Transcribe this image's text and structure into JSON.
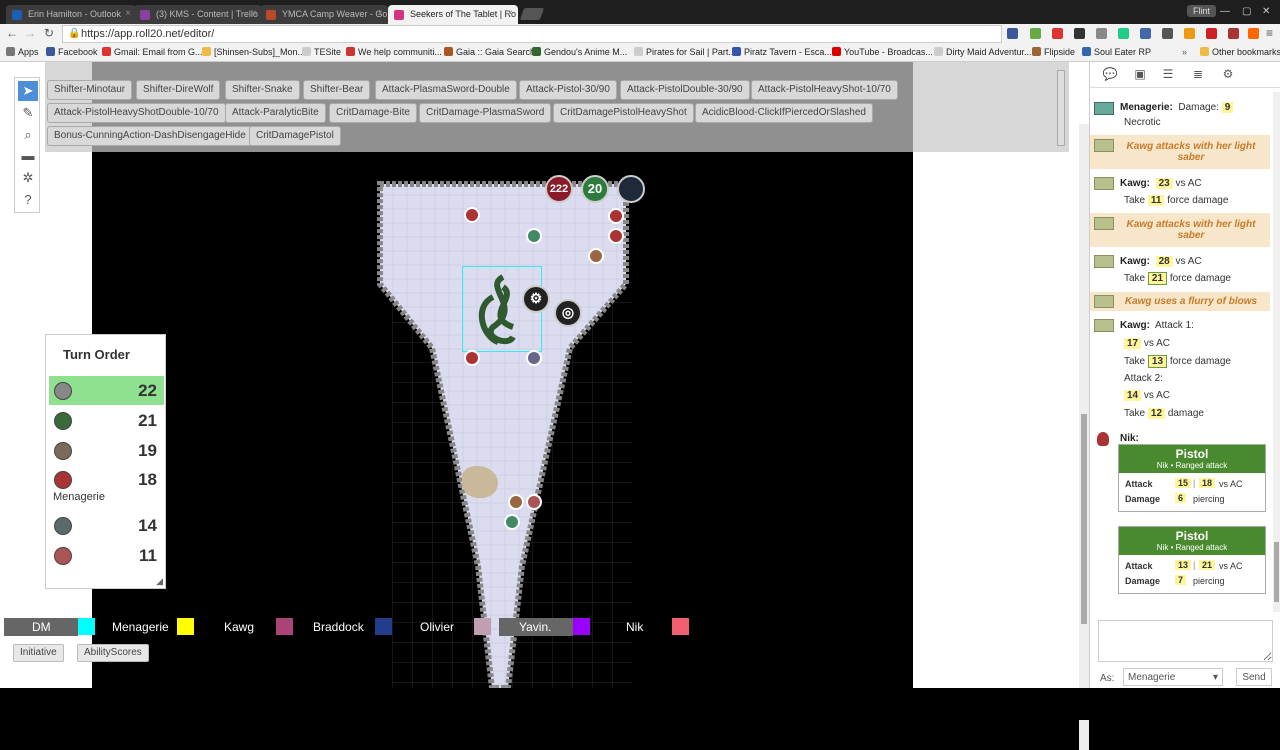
{
  "browser": {
    "tabs": [
      {
        "label": "Erin Hamilton - Outlook",
        "favicon": "#1a5fb4"
      },
      {
        "label": "(3) KMS - Content | Trello",
        "favicon": "#8b3fa0"
      },
      {
        "label": "YMCA Camp Weaver - Go",
        "favicon": "#b84a2b"
      },
      {
        "label": "Seekers of The Tablet | Ro",
        "favicon": "#d6337f"
      }
    ],
    "profile_badge": "Flint",
    "url": "https://app.roll20.net/editor/",
    "bookmarks": [
      "Apps",
      "Facebook",
      "Gmail: Email from G...",
      "[Shinsen-Subs]_Mon...",
      "TESite",
      "We help communiti...",
      "Gaia :: Gaia Search",
      "Gendou's Anime M...",
      "Pirates for Sail | Part...",
      "Piratz Tavern - Esca...",
      "YouTube - Broadcas...",
      "Dirty Maid Adventur...",
      "Flipside",
      "Soul Eater RP"
    ],
    "other_bookmarks": "Other bookmarks"
  },
  "macros": [
    "Shifter-Minotaur",
    "Shifter-DireWolf",
    "Shifter-Snake",
    "Shifter-Bear",
    "Attack-PlasmaSword-Double",
    "Attack-Pistol-30/90",
    "Attack-PistolDouble-30/90",
    "Attack-PistolHeavyShot-10/70",
    "Attack-PistolHeavyShotDouble-10/70",
    "Attack-ParalyticBite",
    "CritDamage-Bite",
    "CritDamage-PlasmaSword",
    "CritDamagePistolHeavyShot",
    "AcidicBlood-ClickIfPiercedOrSlashed",
    "Bonus-CunningAction-DashDisengageHide",
    "CritDamagePistol"
  ],
  "token_bubbles": {
    "bar1": "222",
    "bar2": "20",
    "bar3": ""
  },
  "turn_order": {
    "title": "Turn Order",
    "entries": [
      {
        "value": "22",
        "name": ""
      },
      {
        "value": "21",
        "name": ""
      },
      {
        "value": "19",
        "name": ""
      },
      {
        "value": "18",
        "name": "Menagerie"
      },
      {
        "value": "14",
        "name": ""
      },
      {
        "value": "11",
        "name": ""
      }
    ]
  },
  "players": [
    {
      "name": "DM",
      "color": "#00ffff"
    },
    {
      "name": "Menagerie",
      "color": "#ffff00"
    },
    {
      "name": "Kawg",
      "color": "#aa4477"
    },
    {
      "name": "Braddock",
      "color": "#223e8a"
    },
    {
      "name": "Olivier",
      "color": "#c0a0b0"
    },
    {
      "name": "Yavin.",
      "color": "#9b00ff"
    },
    {
      "name": "Nik",
      "color": "#f06070"
    }
  ],
  "bottom_buttons": [
    "Initiative",
    "AbilityScores"
  ],
  "chat": {
    "m1": {
      "who": "Menagerie:",
      "label": "Damage:",
      "val": "9",
      "type": "Necrotic"
    },
    "e1": "Kawg attacks with her light saber",
    "m2": {
      "who": "Kawg:",
      "atk": "23",
      "vs": "vs AC",
      "take": "Take",
      "dmg": "11",
      "dtype": "force damage"
    },
    "e2": "Kawg attacks with her light saber",
    "m3": {
      "who": "Kawg:",
      "atk": "28",
      "vs": "vs AC",
      "take": "Take",
      "dmg": "21",
      "dtype": "force damage"
    },
    "e3": "Kawg uses a flurry of blows",
    "m4": {
      "who": "Kawg:",
      "a1": "Attack 1:",
      "atk1": "17",
      "vs": "vs AC",
      "take": "Take",
      "dmg1": "13",
      "dtype1": "force damage",
      "a2": "Attack 2:",
      "atk2": "14",
      "dmg2": "12",
      "dtype2": "damage"
    },
    "nik": "Nik:",
    "card1": {
      "title": "Pistol",
      "sub": "Nik • Ranged attack",
      "attack_label": "Attack",
      "r1": "15",
      "r2": "18",
      "vs": "vs AC",
      "damage_label": "Damage",
      "dmg": "6",
      "dtype": "piercing"
    },
    "card2": {
      "title": "Pistol",
      "sub": "Nik • Ranged attack",
      "attack_label": "Attack",
      "r1": "13",
      "r2": "21",
      "vs": "vs AC",
      "damage_label": "Damage",
      "dmg": "7",
      "dtype": "piercing"
    },
    "as_label": "As:",
    "as_value": "Menagerie",
    "send": "Send"
  }
}
